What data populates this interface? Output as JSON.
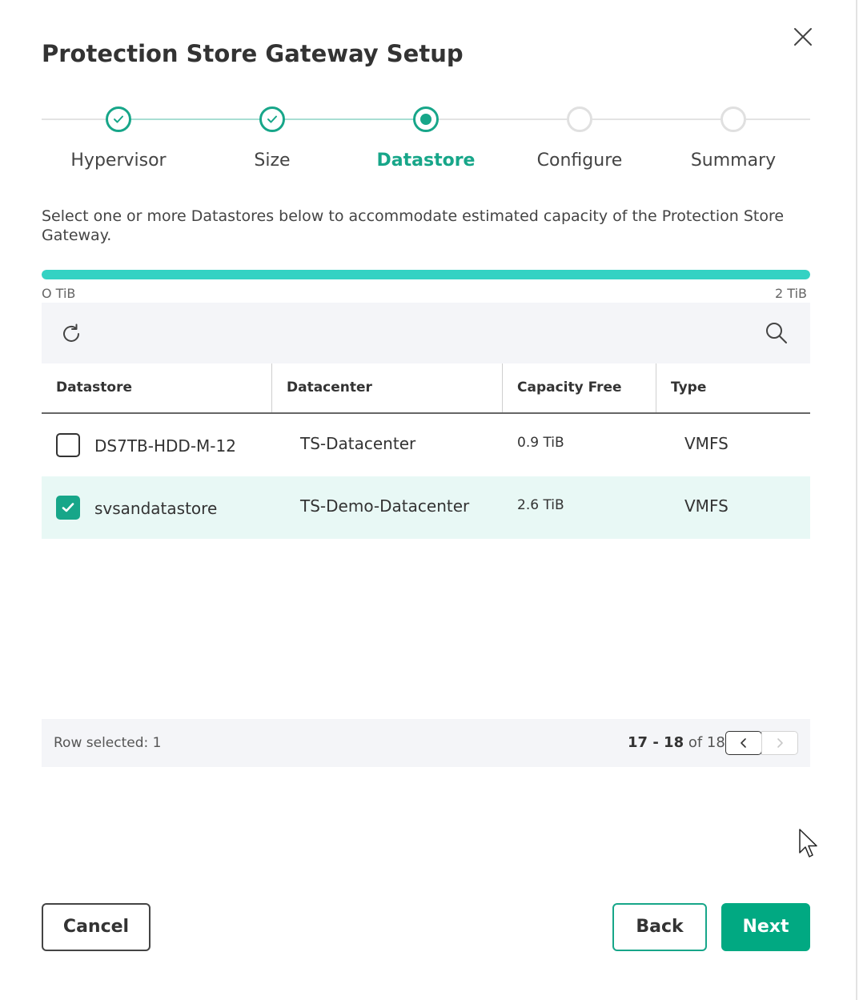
{
  "dialog": {
    "title": "Protection Store Gateway Setup",
    "close_icon": "close-icon"
  },
  "stepper": {
    "steps": [
      {
        "label": "Hypervisor",
        "state": "done"
      },
      {
        "label": "Size",
        "state": "done"
      },
      {
        "label": "Datastore",
        "state": "current"
      },
      {
        "label": "Configure",
        "state": "todo"
      },
      {
        "label": "Summary",
        "state": "todo"
      }
    ]
  },
  "description": "Select one or more Datastores below to accommodate estimated capacity of the Protection Store Gateway.",
  "capacity": {
    "min_label": "O TiB",
    "max_label": "2 TiB",
    "fill_fraction": 1.0,
    "fill_color": "#34d2c3"
  },
  "toolbar": {
    "refresh_icon": "refresh-icon",
    "search_icon": "search-icon"
  },
  "table": {
    "columns": [
      "Datastore",
      "Datacenter",
      "Capacity Free",
      "Type"
    ],
    "rows": [
      {
        "datastore": "DS7TB-HDD-M-12",
        "datacenter": "TS-Datacenter",
        "capacity_free": "0.9 TiB",
        "type": "VMFS",
        "selected": false
      },
      {
        "datastore": "svsandatastore",
        "datacenter": "TS-Demo-Datacenter",
        "capacity_free": "2.6 TiB",
        "type": "VMFS",
        "selected": true
      }
    ]
  },
  "footer": {
    "row_selected": "Row selected: 1",
    "range": "17 - 18",
    "of_total": "of 18"
  },
  "buttons": {
    "cancel": "Cancel",
    "back": "Back",
    "next": "Next"
  },
  "colors": {
    "accent": "#17a689",
    "primary_button": "#01a982",
    "selected_row": "#e8f8f5"
  }
}
